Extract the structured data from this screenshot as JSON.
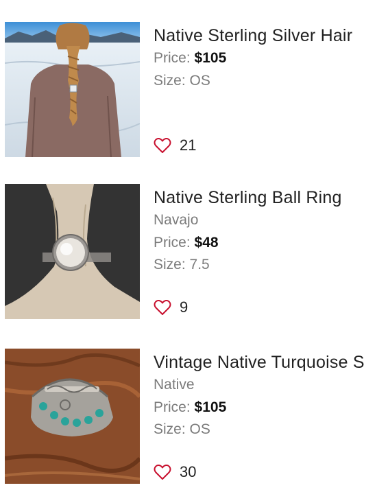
{
  "listings": [
    {
      "title": "Native Sterling Silver Hair",
      "subtitle": "",
      "price_label": "Price:",
      "price": "$105",
      "size_label": "Size:",
      "size": "OS",
      "likes": "21",
      "image": "woman-braid-snow-photo"
    },
    {
      "title": "Native Sterling Ball Ring",
      "subtitle": "Navajo",
      "price_label": "Price:",
      "price": "$48",
      "size_label": "Size:",
      "size": "7.5",
      "likes": "9",
      "image": "ring-on-antler-photo"
    },
    {
      "title": "Vintage Native Turquoise S",
      "subtitle": "Native",
      "price_label": "Price:",
      "price": "$105",
      "size_label": "Size:",
      "size": "OS",
      "likes": "30",
      "image": "turquoise-hair-piece-photo"
    }
  ],
  "icons": {
    "like": "heart-outline-icon"
  },
  "colors": {
    "heart": "#c8102e",
    "title": "#222222",
    "muted": "#7b7b7b"
  }
}
